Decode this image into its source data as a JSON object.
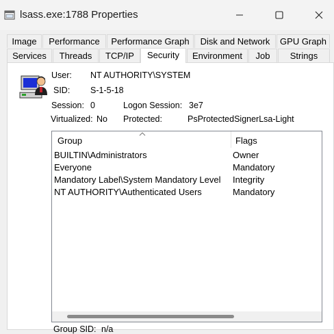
{
  "window": {
    "title": "lsass.exe:1788 Properties"
  },
  "tabs_row1": [
    "Image",
    "Performance",
    "Performance Graph",
    "Disk and Network",
    "GPU Graph"
  ],
  "tabs_row2": [
    "Services",
    "Threads",
    "TCP/IP",
    "Security",
    "Environment",
    "Job",
    "Strings"
  ],
  "active_tab": "Security",
  "security": {
    "user_label": "User:",
    "user_value": "NT AUTHORITY\\SYSTEM",
    "sid_label": "SID:",
    "sid_value": "S-1-5-18",
    "session_label": "Session:",
    "session_value": "0",
    "logon_label": "Logon Session:",
    "logon_value": "3e7",
    "virtualized_label": "Virtualized:",
    "virtualized_value": "No",
    "protected_label": "Protected:",
    "protected_value": "PsProtectedSignerLsa-Light",
    "group_sid_label": "Group SID:",
    "group_sid_value": "n/a"
  },
  "groups_table": {
    "columns": [
      "Group",
      "Flags"
    ],
    "rows": [
      {
        "group": "BUILTIN\\Administrators",
        "flags": "Owner"
      },
      {
        "group": "Everyone",
        "flags": "Mandatory"
      },
      {
        "group": "Mandatory Label\\System Mandatory Level",
        "flags": "Integrity"
      },
      {
        "group": "NT AUTHORITY\\Authenticated Users",
        "flags": "Mandatory"
      }
    ]
  }
}
